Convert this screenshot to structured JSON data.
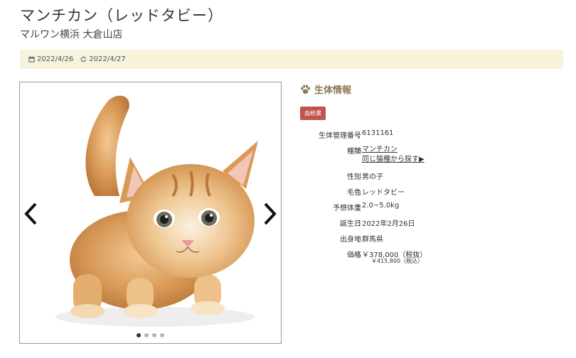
{
  "page": {
    "title": "マンチカン（レッドタビー）",
    "shop": "マルワン横浜 大倉山店"
  },
  "dates": {
    "posted": "2022/4/26",
    "updated": "2022/4/27"
  },
  "icons": [
    "calendar-icon",
    "refresh-icon",
    "paw-icon",
    "chevron-left-icon",
    "chevron-right-icon"
  ],
  "gallery": {
    "image_alt": "子猫の写真",
    "dot_count": 4,
    "active_index": 0
  },
  "info": {
    "heading": "生体情報",
    "badge": "血統書",
    "colors": {
      "heading": "#8a7a52",
      "badge": "#c0534f",
      "datebar": "#f6f2dc"
    },
    "fields": [
      {
        "label": "生体管理番号",
        "value": "6131161"
      },
      {
        "label": "種類",
        "value": "マンチカン",
        "link2": "同じ猫種から探す▶"
      },
      {
        "label": "性別",
        "value": "男の子"
      },
      {
        "label": "毛色",
        "value": "レッドタビー"
      },
      {
        "label": "予想体重",
        "value": "2.0~5.0kg"
      },
      {
        "label": "誕生日",
        "value": "2022年2月26日"
      },
      {
        "label": "出身地",
        "value": "群馬県"
      },
      {
        "label": "価格",
        "value": "￥378,000（税抜）"
      }
    ],
    "price_with_tax": "￥415,800（税込）"
  }
}
